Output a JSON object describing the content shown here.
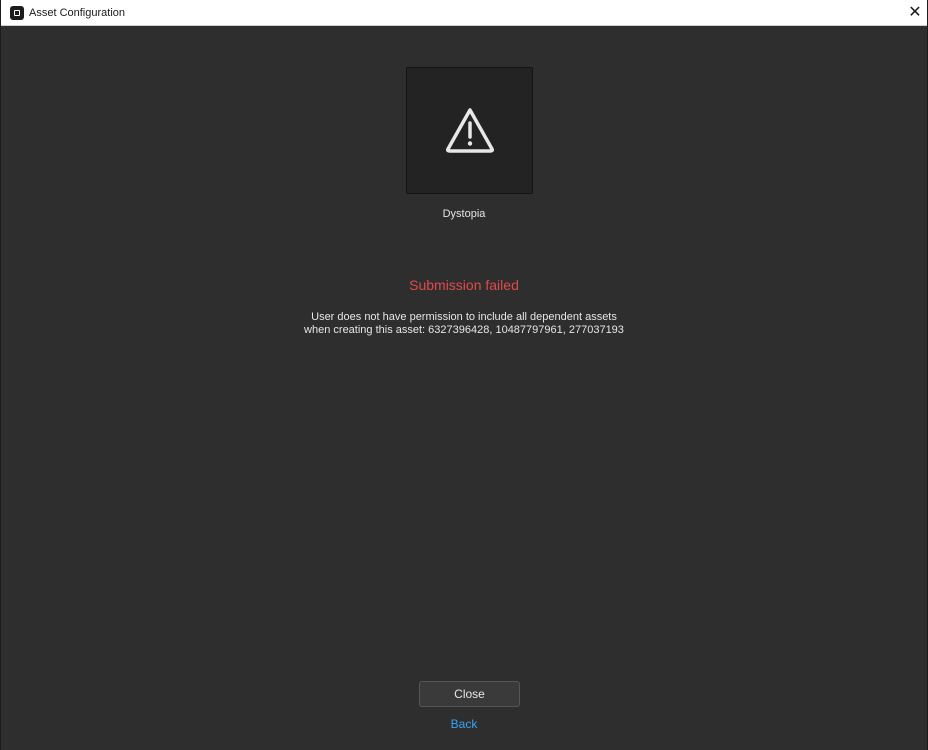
{
  "window": {
    "title": "Asset Configuration",
    "close_glyph": "✕",
    "app_icon": "roblox-studio-icon",
    "close_icon": "close-icon"
  },
  "asset": {
    "name": "Dystopia",
    "thumbnail_icon": "warning-triangle-icon"
  },
  "status": {
    "title": "Submission failed",
    "message_line1": "User does not have permission to include all dependent assets",
    "message_line2": "when creating this asset: 6327396428, 10487797961, 277037193",
    "title_color": "#e04a4a"
  },
  "actions": {
    "close_label": "Close",
    "back_label": "Back",
    "link_color": "#3aa3f5"
  }
}
